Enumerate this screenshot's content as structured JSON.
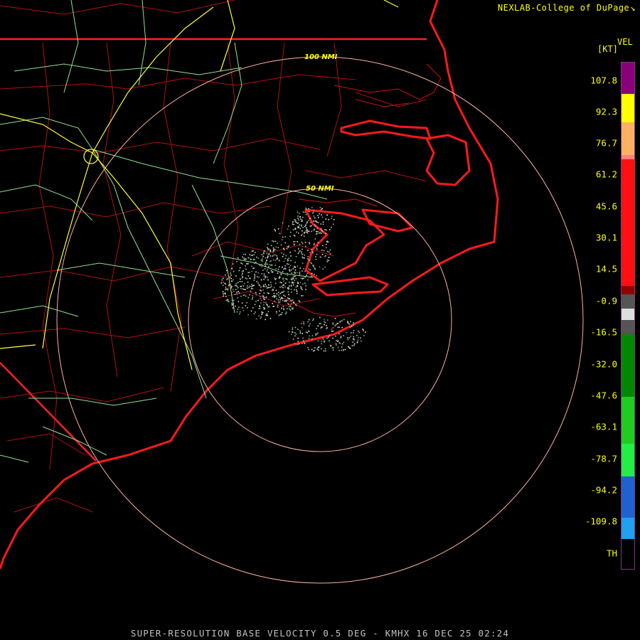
{
  "credit": "NEXLAB-College of DuPage",
  "legend": {
    "title_top": "VEL",
    "title_unit": "[KT]",
    "labels": [
      "107.8",
      "92.3",
      "76.7",
      "61.2",
      "45.6",
      "30.1",
      "14.5",
      "-0.9",
      "-16.5",
      "-32.0",
      "-47.6",
      "-63.1",
      "-78.7",
      "-94.2",
      "-109.8",
      "TH"
    ]
  },
  "range_rings": [
    {
      "label": "50 NMI"
    },
    {
      "label": "100 NMI"
    }
  ],
  "caption": "SUPER-RESOLUTION BASE VELOCITY 0.5 DEG - KMHX 16 DEC 25 02:24",
  "colors": {
    "background": "#000000",
    "coastline": "#ff1a1a",
    "county_lines": "#b01010",
    "highways_major": "#ffff33",
    "highways_minor": "#90e090",
    "rings": "#ffb0a0",
    "text": "#ffff00"
  }
}
